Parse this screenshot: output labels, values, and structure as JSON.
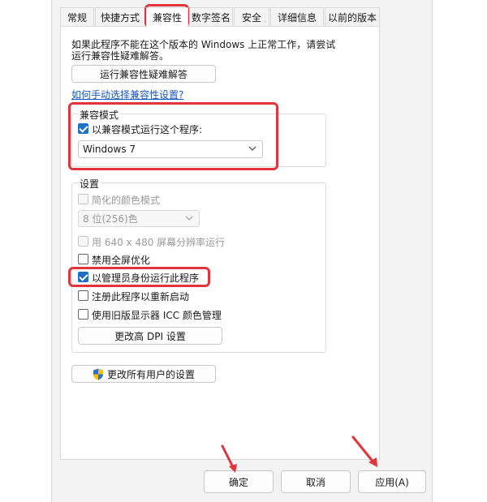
{
  "tabs": [
    {
      "label": "常规"
    },
    {
      "label": "快捷方式"
    },
    {
      "label": "兼容性",
      "active": true
    },
    {
      "label": "数字签名"
    },
    {
      "label": "安全"
    },
    {
      "label": "详细信息"
    },
    {
      "label": "以前的版本"
    }
  ],
  "intro": {
    "line1": "如果此程序不能在这个版本的 Windows 上正常工作，请尝试",
    "line2": "运行兼容性疑难解答。"
  },
  "troubleshoot_button": "运行兼容性疑难解答",
  "manual_link": "如何手动选择兼容性设置?",
  "compat_mode": {
    "title": "兼容模式",
    "checkbox_label": "以兼容模式运行这个程序:",
    "checked": true,
    "os_selected": "Windows 7"
  },
  "settings": {
    "title": "设置",
    "reduced_color": {
      "label": "简化的颜色模式",
      "checked": false,
      "enabled": false
    },
    "color_select": "8 位(256)色",
    "res_640": {
      "label": "用 640 x 480 屏幕分辨率运行",
      "checked": false,
      "enabled": false
    },
    "disable_fullscreen": {
      "label": "禁用全屏优化",
      "checked": false
    },
    "run_as_admin": {
      "label": "以管理员身份运行此程序",
      "checked": true
    },
    "register_restart": {
      "label": "注册此程序以重新启动",
      "checked": false
    },
    "legacy_icc": {
      "label": "使用旧版显示器 ICC 颜色管理",
      "checked": false
    },
    "dpi_button": "更改高 DPI 设置"
  },
  "all_users_button": "更改所有用户的设置",
  "footer": {
    "ok": "确定",
    "cancel": "取消",
    "apply": "应用(A)"
  },
  "colors": {
    "highlight": "#e2343c",
    "checkbox_accent": "#1f6fc7",
    "link": "#1a56c4"
  },
  "icons": {
    "shield": "uac-shield-icon",
    "arrow": "red-arrow-icon"
  }
}
